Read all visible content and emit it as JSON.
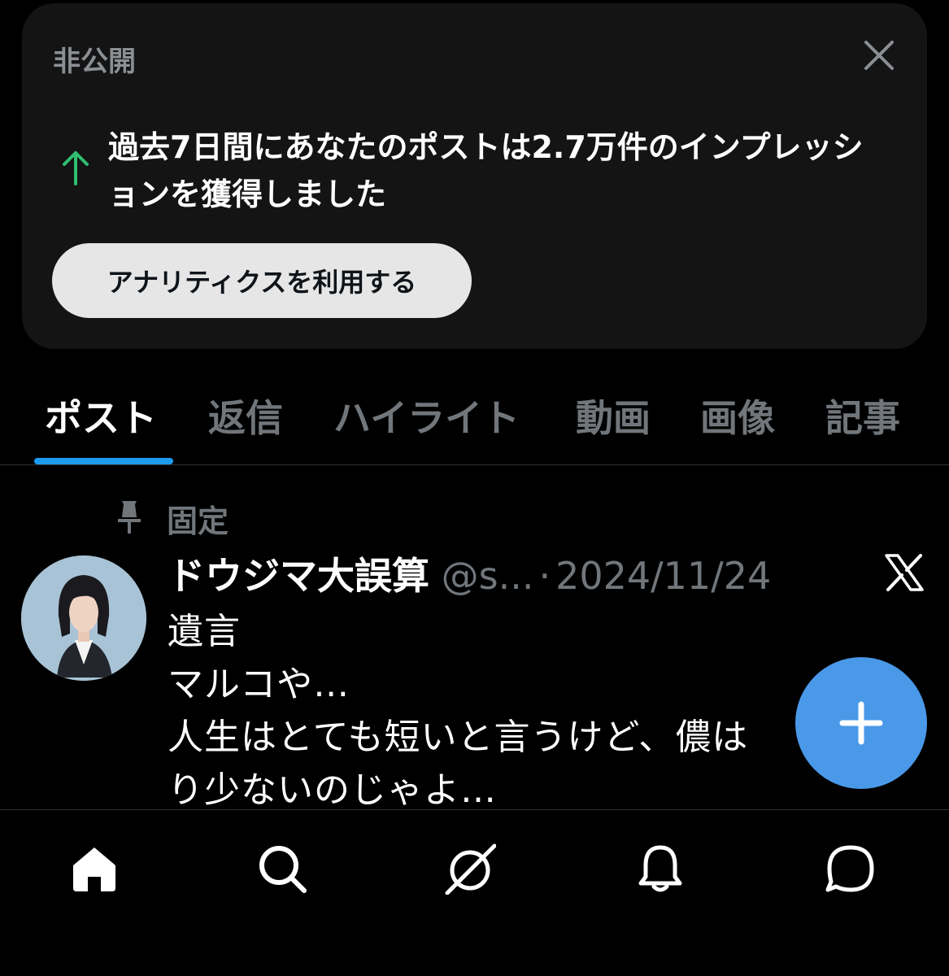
{
  "analytics_card": {
    "privacy_label": "非公開",
    "message": "過去7日間にあなたのポストは2.7万件のインプレッションを獲得しました",
    "button_label": "アナリティクスを利用する",
    "trend_color": "#2fbf71",
    "close_icon": "close-icon"
  },
  "tabs": [
    {
      "label": "ポスト",
      "active": true
    },
    {
      "label": "返信",
      "active": false
    },
    {
      "label": "ハイライト",
      "active": false
    },
    {
      "label": "動画",
      "active": false
    },
    {
      "label": "画像",
      "active": false
    },
    {
      "label": "記事",
      "active": false
    }
  ],
  "post": {
    "pinned_label": "固定",
    "author": "ドウジマ大誤算",
    "handle": "@s...",
    "separator": "·",
    "date": "2024/11/24",
    "lines": [
      "遺言",
      "マルコや…",
      "人生はとても短いと言うけど、儂は",
      "り少ないのじゃよ…"
    ]
  },
  "fab": {
    "icon": "plus-icon",
    "color": "#4a99e9"
  },
  "bottom_nav": {
    "items": [
      "home-icon",
      "search-icon",
      "grok-icon",
      "notifications-icon",
      "messages-icon"
    ]
  },
  "colors": {
    "background": "#000000",
    "card": "#141414",
    "accent": "#1d9bf0",
    "muted": "#71767b"
  }
}
